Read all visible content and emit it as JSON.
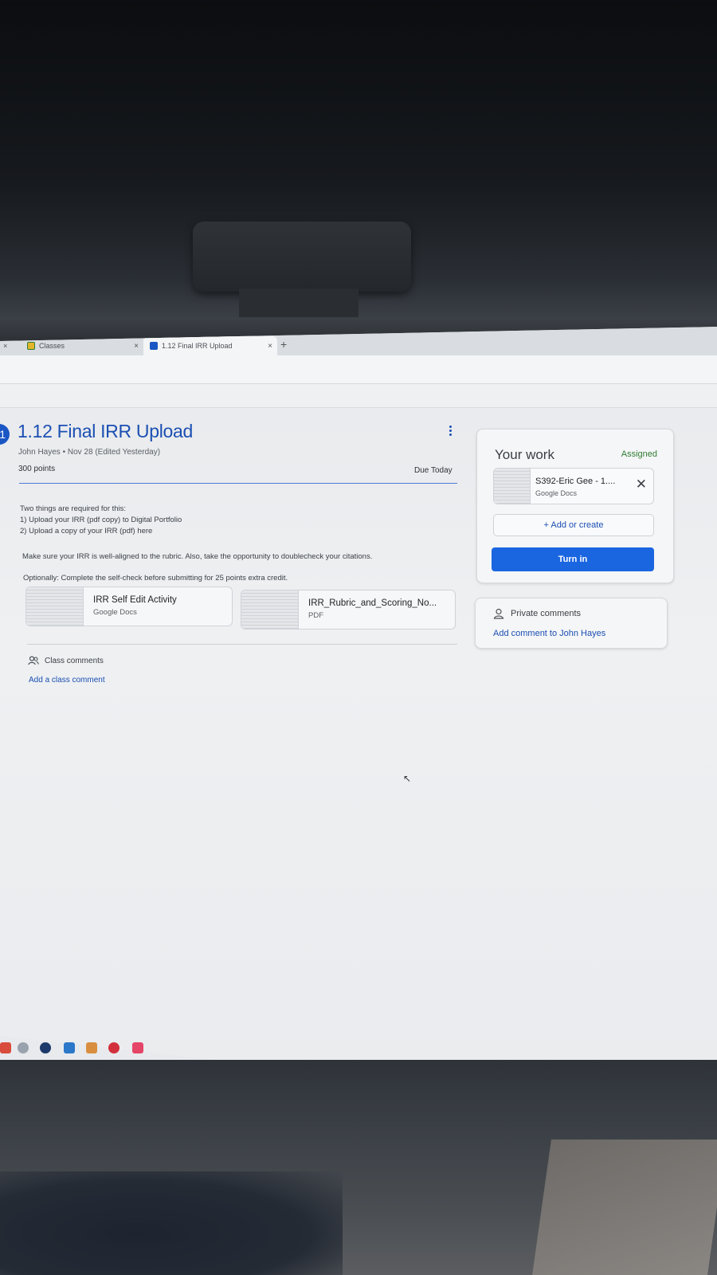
{
  "browser": {
    "tabs": [
      {
        "label": "Classes",
        "close": "×"
      },
      {
        "label": "1.12 Final IRR Upload",
        "close": "×"
      }
    ],
    "prev_tab_close": "×",
    "new_tab": "+"
  },
  "assignment": {
    "badge": "1",
    "title": "1.12 Final IRR Upload",
    "meta": "John Hayes • Nov 28 (Edited Yesterday)",
    "points": "300 points",
    "due": "Due Today",
    "description": [
      "Two things are required for this:",
      "1) Upload your IRR (pdf copy) to Digital Portfolio",
      "2) Upload a copy of your IRR (pdf) here",
      "Make sure your IRR is well-aligned to the rubric. Also, take the opportunity to doublecheck your citations.",
      "Optionally: Complete the self-check before submitting for 25 points extra credit."
    ],
    "attachments": [
      {
        "name": "IRR Self Edit Activity",
        "type": "Google Docs"
      },
      {
        "name": "IRR_Rubric_and_Scoring_No...",
        "type": "PDF"
      }
    ],
    "class_comments": {
      "label": "Class comments",
      "add": "Add a class comment"
    }
  },
  "your_work": {
    "title": "Your work",
    "status": "Assigned",
    "file": {
      "name": "S392-Eric Gee - 1....",
      "type": "Google Docs",
      "remove": "✕"
    },
    "add_label": "+ Add or create",
    "turn_in": "Turn in"
  },
  "private_comments": {
    "label": "Private comments",
    "add": "Add comment to John Hayes"
  },
  "colors": {
    "accent": "#1b4fb3",
    "turn_in_button": "#1a66e0",
    "assigned_status": "#2e7d32"
  },
  "taskbar_icons": [
    "chrome-icon",
    "app-icon",
    "steam-icon",
    "app-icon",
    "folder-icon",
    "opera-icon",
    "pocket-icon"
  ]
}
